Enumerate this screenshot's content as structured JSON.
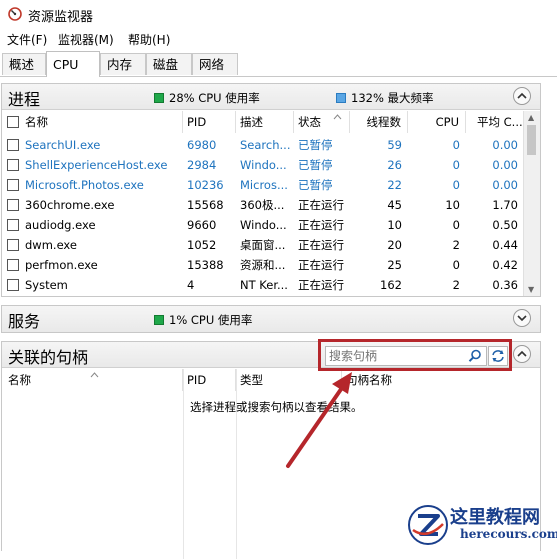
{
  "window": {
    "title": "资源监视器"
  },
  "menu": {
    "items": [
      "文件(F)",
      "监视器(M)",
      "帮助(H)"
    ]
  },
  "tabs": [
    "概述",
    "CPU",
    "内存",
    "磁盘",
    "网络"
  ],
  "active_tab": "CPU",
  "processes": {
    "title": "进程",
    "cpu_usage": "28% CPU 使用率",
    "max_freq": "132% 最大频率",
    "columns": [
      "名称",
      "PID",
      "描述",
      "状态",
      "线程数",
      "CPU",
      "平均 C..."
    ],
    "rows": [
      {
        "name": "SearchUI.exe",
        "pid": "6980",
        "desc": "Search...",
        "status": "已暂停",
        "threads": "59",
        "cpu": "0",
        "avg": "0.00",
        "suspended": true
      },
      {
        "name": "ShellExperienceHost.exe",
        "pid": "2984",
        "desc": "Windo...",
        "status": "已暂停",
        "threads": "26",
        "cpu": "0",
        "avg": "0.00",
        "suspended": true
      },
      {
        "name": "Microsoft.Photos.exe",
        "pid": "10236",
        "desc": "Micros...",
        "status": "已暂停",
        "threads": "22",
        "cpu": "0",
        "avg": "0.00",
        "suspended": true
      },
      {
        "name": "360chrome.exe",
        "pid": "15568",
        "desc": "360极...",
        "status": "正在运行",
        "threads": "45",
        "cpu": "10",
        "avg": "1.70",
        "suspended": false
      },
      {
        "name": "audiodg.exe",
        "pid": "9660",
        "desc": "Windo...",
        "status": "正在运行",
        "threads": "10",
        "cpu": "0",
        "avg": "0.50",
        "suspended": false
      },
      {
        "name": "dwm.exe",
        "pid": "1052",
        "desc": "桌面窗...",
        "status": "正在运行",
        "threads": "20",
        "cpu": "2",
        "avg": "0.44",
        "suspended": false
      },
      {
        "name": "perfmon.exe",
        "pid": "15388",
        "desc": "资源和...",
        "status": "正在运行",
        "threads": "25",
        "cpu": "0",
        "avg": "0.42",
        "suspended": false
      },
      {
        "name": "System",
        "pid": "4",
        "desc": "NT Ker...",
        "status": "正在运行",
        "threads": "162",
        "cpu": "2",
        "avg": "0.36",
        "suspended": false
      }
    ]
  },
  "services": {
    "title": "服务",
    "cpu_usage": "1% CPU 使用率"
  },
  "handles": {
    "title": "关联的句柄",
    "search_placeholder": "搜索句柄",
    "columns": [
      "名称",
      "PID",
      "类型",
      "句柄名称"
    ],
    "empty_message": "选择进程或搜索句柄以查看结果。"
  },
  "watermark": {
    "text": "这里教程网",
    "sub": "herecours.com"
  },
  "colors": {
    "suspended_text": "#1e73be",
    "highlight": "#b5262b",
    "cpu_green": "#1fa84a",
    "freq_blue": "#5aa6e4"
  }
}
